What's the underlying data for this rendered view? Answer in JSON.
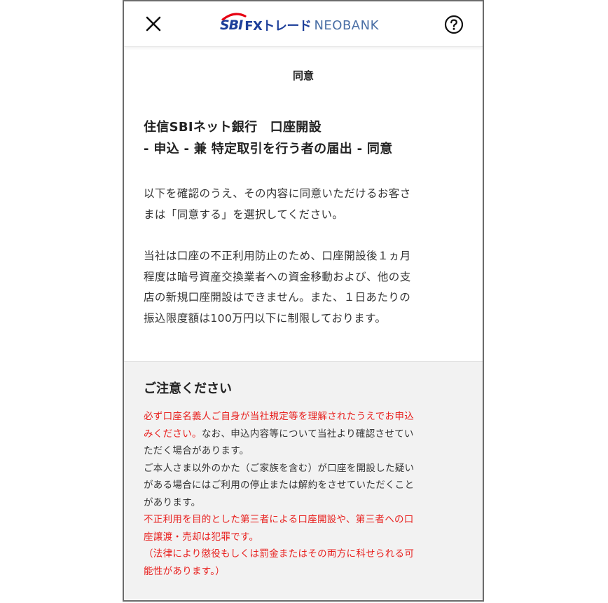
{
  "header": {
    "logo_sbi": "SBI",
    "logo_fx": "FXトレード",
    "logo_neo": "NEOBANK",
    "close_icon": "close-icon",
    "help_icon": "help-icon"
  },
  "page_title": "同意",
  "heading": {
    "line1": "住信SBIネット銀行　口座開設",
    "line2": "- 申込 - 兼 特定取引を行う者の届出 - 同意"
  },
  "intro": {
    "line1": "以下を確認のうえ、その内容に同意いただけるお客さ",
    "line2": "まは「同意する」を選択してください。"
  },
  "restriction": {
    "line1": "当社は口座の不正利用防止のため、口座開設後１ヵ月",
    "line2": "程度は暗号資産交換業者への資金移動および、他の支",
    "line3": "店の新規口座開設はできません。また、１日あたりの",
    "line4": "振込限度額は100万円以下に制限しております。"
  },
  "notice": {
    "title": "ご注意ください",
    "l1": "必ず口座名義人ご自身が当社規定等を理解されたうえでお申込",
    "l2_red": "みください。",
    "l2_black": "なお、申込内容等について当社より確認させてい",
    "l3": "ただく場合があります。",
    "l4": "ご本人さま以外のかた（ご家族を含む）が口座を開設した疑い",
    "l5": "がある場合にはご利用の停止または解約をさせていただくこと",
    "l6": "があります。",
    "l7": "不正利用を目的とした第三者による口座開設や、第三者への口",
    "l8": "座譲渡・売却は犯罪です。",
    "l9": "（法律により懲役もしくは罰金またはその両方に科せられる可",
    "l10": "能性があります。）"
  },
  "colors": {
    "accent_red": "#e8201e",
    "brand_blue": "#1d3f9a",
    "notice_bg": "#f2f2f2"
  }
}
